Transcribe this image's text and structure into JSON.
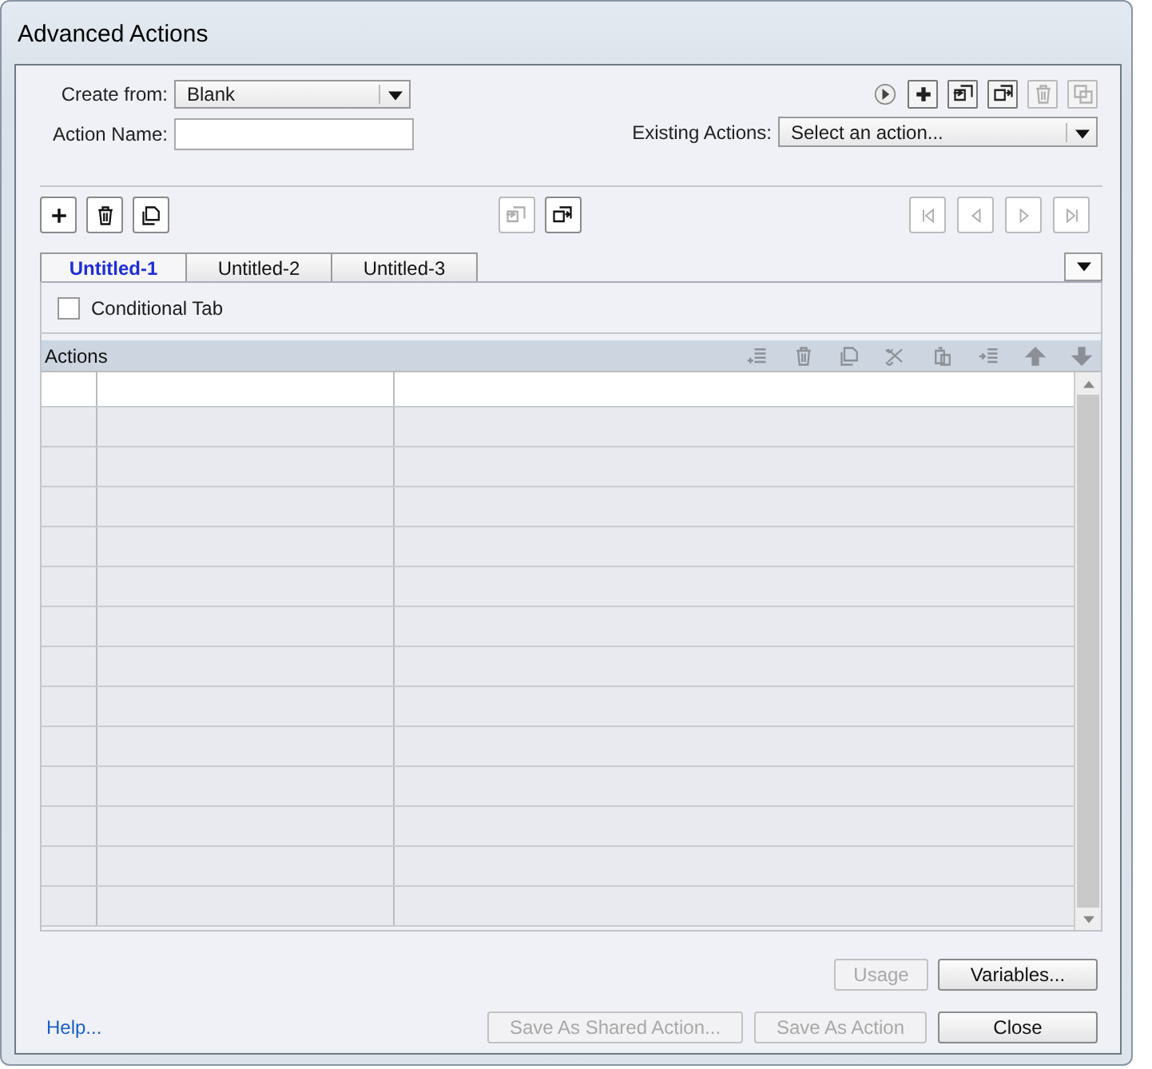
{
  "window": {
    "title": "Advanced Actions"
  },
  "create_from": {
    "label": "Create from:",
    "value": "Blank"
  },
  "action_name": {
    "label": "Action Name:"
  },
  "top_tools": [
    {
      "kind": "play",
      "disabled": false
    },
    {
      "kind": "add",
      "disabled": false
    },
    {
      "kind": "import",
      "disabled": false
    },
    {
      "kind": "export",
      "disabled": false
    },
    {
      "kind": "delete",
      "disabled": true
    },
    {
      "kind": "duplicate",
      "disabled": true
    }
  ],
  "existing_actions": {
    "label": "Existing Actions:",
    "value": "Select an action..."
  },
  "tab_tools_left": [
    {
      "kind": "add",
      "disabled": false
    },
    {
      "kind": "delete",
      "disabled": false
    },
    {
      "kind": "copy",
      "disabled": false
    }
  ],
  "tab_tools_middle": [
    {
      "kind": "import",
      "disabled": true
    },
    {
      "kind": "export",
      "disabled": false
    }
  ],
  "tab_tools_right": [
    {
      "kind": "first",
      "disabled": true
    },
    {
      "kind": "prev",
      "disabled": true
    },
    {
      "kind": "next",
      "disabled": true
    },
    {
      "kind": "last",
      "disabled": true
    }
  ],
  "tabs": [
    {
      "label": "Untitled-1",
      "selected": true
    },
    {
      "label": "Untitled-2",
      "selected": false
    },
    {
      "label": "Untitled-3",
      "selected": false
    }
  ],
  "conditional_tab": {
    "label": "Conditional Tab",
    "checked": false
  },
  "actions": {
    "title": "Actions",
    "tools": [
      {
        "kind": "insert",
        "disabled": true
      },
      {
        "kind": "delete",
        "disabled": true
      },
      {
        "kind": "copy",
        "disabled": true
      },
      {
        "kind": "cut",
        "disabled": true
      },
      {
        "kind": "paste",
        "disabled": true
      },
      {
        "kind": "indent",
        "disabled": true
      },
      {
        "kind": "up",
        "disabled": true
      },
      {
        "kind": "down",
        "disabled": true
      }
    ],
    "rows": [
      {
        "selected": true
      },
      {
        "selected": false
      },
      {
        "selected": false
      },
      {
        "selected": false
      },
      {
        "selected": false
      },
      {
        "selected": false
      },
      {
        "selected": false
      },
      {
        "selected": false
      },
      {
        "selected": false
      },
      {
        "selected": false
      },
      {
        "selected": false
      },
      {
        "selected": false
      },
      {
        "selected": false
      },
      {
        "selected": false
      }
    ]
  },
  "buttons_row1": [
    {
      "label": "Usage",
      "disabled": true
    },
    {
      "label": "Variables...",
      "disabled": false
    }
  ],
  "help_link": "Help...",
  "buttons_row2": [
    {
      "label": "Save As Shared Action...",
      "disabled": true
    },
    {
      "label": "Save As Action",
      "disabled": true
    },
    {
      "label": "Close",
      "disabled": false
    }
  ]
}
